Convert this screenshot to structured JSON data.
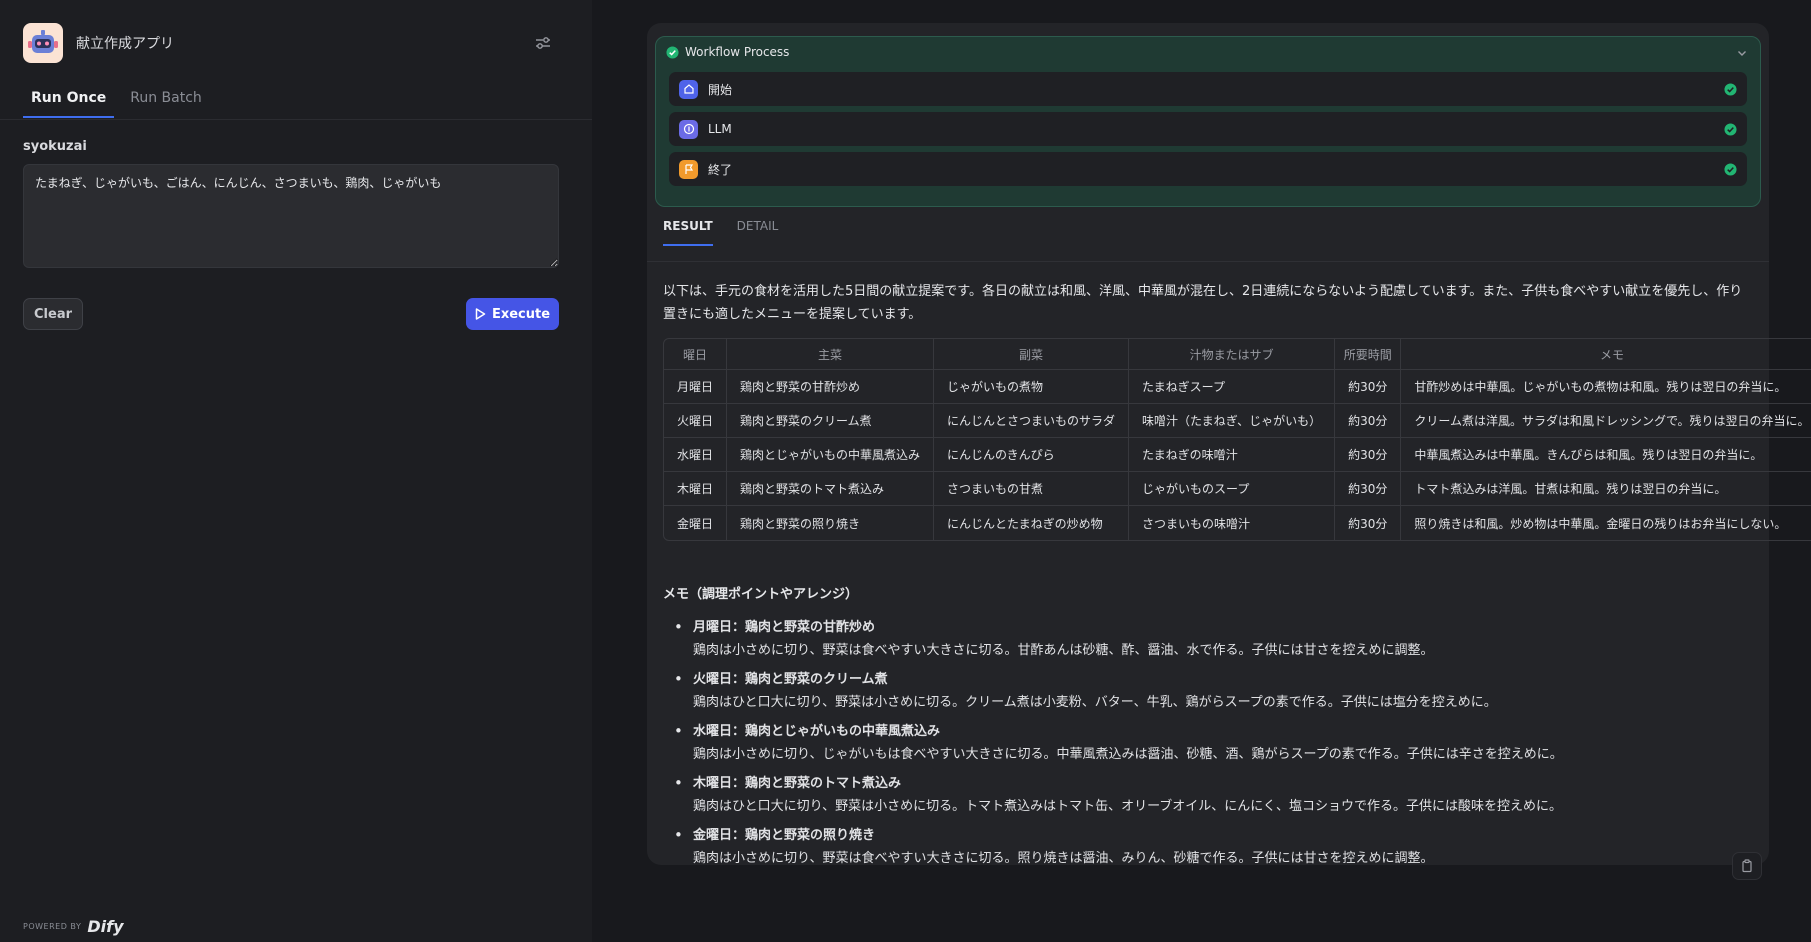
{
  "app": {
    "title": "献立作成アプリ"
  },
  "tabs": [
    {
      "label": "Run Once",
      "active": true
    },
    {
      "label": "Run Batch",
      "active": false
    }
  ],
  "form": {
    "field_label": "syokuzai",
    "field_value": "たまねぎ、じゃがいも、ごはん、にんじん、さつまいも、鶏肉、じゃがいも",
    "clear_label": "Clear",
    "execute_label": "Execute"
  },
  "footer": {
    "powered_by": "POWERED BY",
    "brand": "Dify"
  },
  "workflow": {
    "title": "Workflow Process",
    "steps": [
      {
        "name": "開始",
        "icon": "home-icon",
        "color": "#4f63e9"
      },
      {
        "name": "LLM",
        "icon": "llm-icon",
        "color": "#6b6be6"
      },
      {
        "name": "終了",
        "icon": "flag-icon",
        "color": "#f19a2c"
      }
    ],
    "status_color": "#22b573"
  },
  "result_tabs": [
    {
      "label": "RESULT",
      "active": true
    },
    {
      "label": "DETAIL",
      "active": false
    }
  ],
  "result": {
    "intro": "以下は、手元の食材を活用した5日間の献立提案です。各日の献立は和風、洋風、中華風が混在し、2日連続にならないよう配慮しています。また、子供も食べやすい献立を優先し、作り置きにも適したメニューを提案しています。",
    "table": {
      "headers": [
        "曜日",
        "主菜",
        "副菜",
        "汁物またはサブ",
        "所要時間",
        "メモ"
      ],
      "rows": [
        [
          "月曜日",
          "鶏肉と野菜の甘酢炒め",
          "じゃがいもの煮物",
          "たまねぎスープ",
          "約30分",
          "甘酢炒めは中華風。じゃがいもの煮物は和風。残りは翌日の弁当に。"
        ],
        [
          "火曜日",
          "鶏肉と野菜のクリーム煮",
          "にんじんとさつまいものサラダ",
          "味噌汁（たまねぎ、じゃがいも）",
          "約30分",
          "クリーム煮は洋風。サラダは和風ドレッシングで。残りは翌日の弁当に。"
        ],
        [
          "水曜日",
          "鶏肉とじゃがいもの中華風煮込み",
          "にんじんのきんぴら",
          "たまねぎの味噌汁",
          "約30分",
          "中華風煮込みは中華風。きんぴらは和風。残りは翌日の弁当に。"
        ],
        [
          "木曜日",
          "鶏肉と野菜のトマト煮込み",
          "さつまいもの甘煮",
          "じゃがいものスープ",
          "約30分",
          "トマト煮込みは洋風。甘煮は和風。残りは翌日の弁当に。"
        ],
        [
          "金曜日",
          "鶏肉と野菜の照り焼き",
          "にんじんとたまねぎの炒め物",
          "さつまいもの味噌汁",
          "約30分",
          "照り焼きは和風。炒め物は中華風。金曜日の残りはお弁当にしない。"
        ]
      ]
    },
    "memo_title": "メモ（調理ポイントやアレンジ）",
    "notes": [
      {
        "head": "月曜日：鶏肉と野菜の甘酢炒め",
        "body": "鶏肉は小さめに切り、野菜は食べやすい大きさに切る。甘酢あんは砂糖、酢、醤油、水で作る。子供には甘さを控えめに調整。"
      },
      {
        "head": "火曜日：鶏肉と野菜のクリーム煮",
        "body": "鶏肉はひと口大に切り、野菜は小さめに切る。クリーム煮は小麦粉、バター、牛乳、鶏がらスープの素で作る。子供には塩分を控えめに。"
      },
      {
        "head": "水曜日：鶏肉とじゃがいもの中華風煮込み",
        "body": "鶏肉は小さめに切り、じゃがいもは食べやすい大きさに切る。中華風煮込みは醤油、砂糖、酒、鶏がらスープの素で作る。子供には辛さを控えめに。"
      },
      {
        "head": "木曜日：鶏肉と野菜のトマト煮込み",
        "body": "鶏肉はひと口大に切り、野菜は小さめに切る。トマト煮込みはトマト缶、オリーブオイル、にんにく、塩コショウで作る。子供には酸味を控えめに。"
      },
      {
        "head": "金曜日：鶏肉と野菜の照り焼き",
        "body": "鶏肉は小さめに切り、野菜は食べやすい大きさに切る。照り焼きは醤油、みりん、砂糖で作る。子供には甘さを控えめに調整。"
      }
    ]
  }
}
